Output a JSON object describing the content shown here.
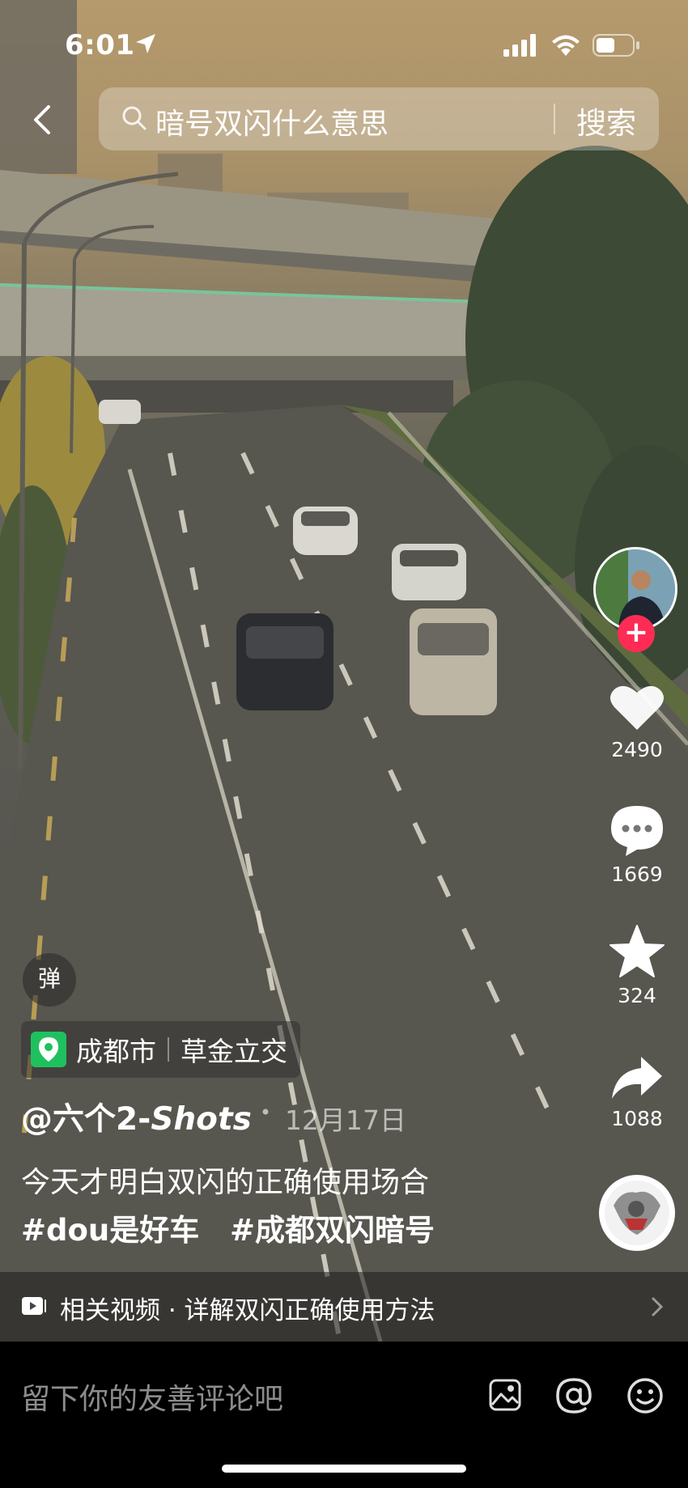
{
  "status_bar": {
    "time": "6:01"
  },
  "search": {
    "query": "暗号双闪什么意思",
    "button": "搜索"
  },
  "actions": {
    "likes": "2490",
    "comments": "1669",
    "favorites": "324",
    "shares": "1088"
  },
  "danmu_label": "弹",
  "location": {
    "city": "成都市",
    "place": "草金立交"
  },
  "post": {
    "author_prefix": "@六个2-",
    "author_suffix": "Shots",
    "date": "12月17日",
    "caption": "今天才明白双闪的正确使用场合",
    "tag1": "#dou是好车",
    "tag2": "#成都双闪暗号"
  },
  "related": {
    "text": "相关视频 · 详解双闪正确使用方法"
  },
  "comment_bar": {
    "placeholder": "留下你的友善评论吧"
  },
  "colors": {
    "follow": "#fe2c55",
    "location_pin": "#1fc15f"
  }
}
